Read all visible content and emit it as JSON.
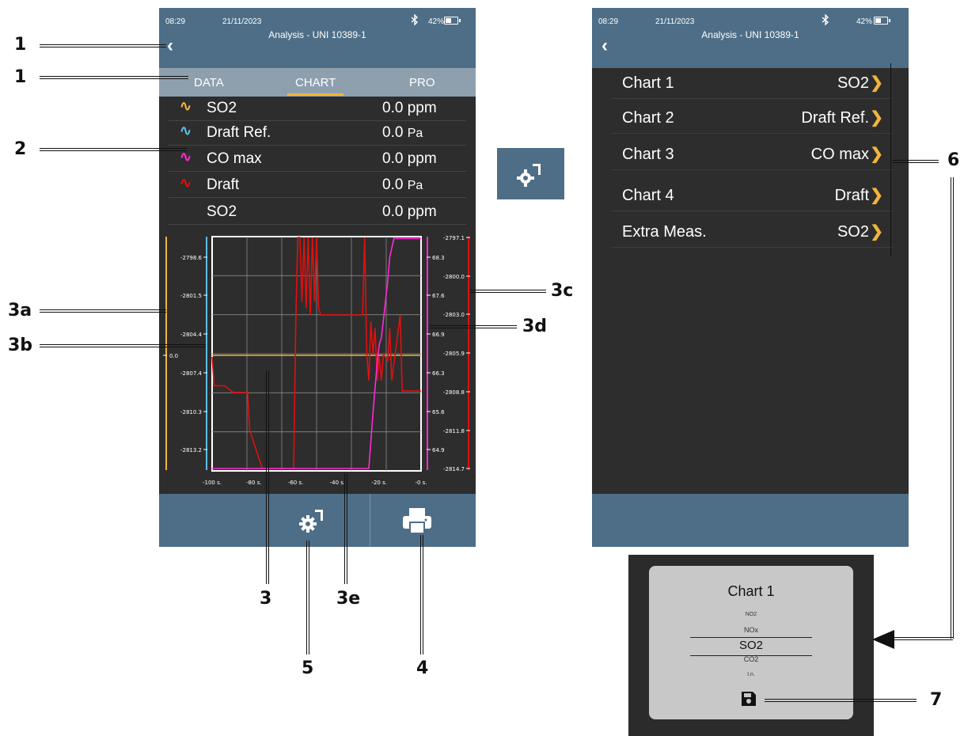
{
  "screen_left": {
    "status": {
      "time": "08:29",
      "date": "21/11/2023",
      "battery": "42%",
      "title": "Analysis - UNI 10389-1"
    },
    "tabs": [
      {
        "label": "DATA"
      },
      {
        "label": "CHART"
      },
      {
        "label": "PRO"
      }
    ],
    "active_tab": "CHART",
    "legend": [
      {
        "name": "SO2",
        "value": "0.0",
        "unit": "ppm",
        "icon": "yellow-trend-icon",
        "color": "#f2b43a"
      },
      {
        "name": "Draft Ref.",
        "value": "0.0",
        "unit": "Pa",
        "icon": "blue-trend-icon",
        "color": "#5bc0e6"
      },
      {
        "name": "CO max",
        "value": "0.0",
        "unit": "ppm",
        "icon": "magenta-trend-icon",
        "color": "#ff2ad4"
      },
      {
        "name": "Draft",
        "value": "0.0",
        "unit": "Pa",
        "icon": "red-trend-icon",
        "color": "#e01010"
      },
      {
        "name": "SO2",
        "value": "0.0",
        "unit": "ppm",
        "icon": "",
        "color": ""
      }
    ],
    "bottom_buttons": {
      "settings_icon": "gear-probe-icon",
      "print_icon": "printer-icon"
    }
  },
  "chart_data": {
    "type": "line",
    "x_ticks": [
      "-100 s.",
      "-80 s.",
      "-60 s.",
      "-40 s.",
      "-20 s.",
      "-0 s."
    ],
    "axis_a_ticks": [
      "0.0"
    ],
    "axis_b_ticks": [
      "-2798.6",
      "-2801.5",
      "-2804.4",
      "-2807.4",
      "-2810.3",
      "-2813.2"
    ],
    "axis_d_ticks": [
      "68.3",
      "67.6",
      "66.9",
      "66.3",
      "65.6",
      "64.9"
    ],
    "axis_c_ticks": [
      "-2797.1",
      "-2800.0",
      "-2803.0",
      "-2805.9",
      "-2808.8",
      "-2811.8",
      "-2814.7"
    ],
    "series": [
      {
        "color": "#f2b43a",
        "x": [
          -100,
          0
        ],
        "y": [
          0.0,
          0.0
        ]
      },
      {
        "color": "#e01010",
        "x": [
          -100,
          -99,
          -94,
          -90,
          -85,
          -83,
          -82,
          -76,
          -75,
          -61,
          -60,
          -59,
          -58,
          -57,
          -56,
          -55,
          -54,
          -53,
          -52,
          -51,
          -50,
          -49,
          -48,
          -47,
          -28,
          -27,
          -26,
          -25,
          -24,
          -23,
          -22,
          -21,
          -20,
          -19,
          -18,
          -16,
          -15,
          -14,
          -10,
          -9,
          -8,
          0
        ],
        "y": [
          -2806.2,
          -2808.4,
          -2808.4,
          -2808.9,
          -2808.9,
          -2808.9,
          -2811.8,
          -2814.7,
          -2814.7,
          -2814.7,
          -2804.0,
          -2797.1,
          -2797.1,
          -2802.0,
          -2797.1,
          -2802.5,
          -2797.1,
          -2803.0,
          -2797.1,
          -2802.0,
          -2797.1,
          -2802.5,
          -2803.0,
          -2803.0,
          -2803.0,
          -2797.1,
          -2806.0,
          -2808.0,
          -2803.5,
          -2806.0,
          -2804.0,
          -2808.0,
          -2806.2,
          -2808.0,
          -2806.0,
          -2806.5,
          -2804.0,
          -2808.0,
          -2803.0,
          -2808.8,
          -2808.8,
          -2808.8
        ]
      },
      {
        "color": "#ff2ad4",
        "x": [
          -100,
          -25,
          -23,
          -22,
          -21,
          -20,
          -19,
          -18,
          -17,
          -16,
          -15,
          -13,
          -12,
          0
        ],
        "y": [
          64.9,
          64.9,
          65.8,
          66.2,
          66.6,
          66.9,
          67.0,
          67.3,
          67.6,
          67.9,
          68.3,
          68.6,
          68.6,
          68.6
        ]
      }
    ]
  },
  "floating_settings_icon": "gear-probe-icon",
  "screen_right": {
    "status": {
      "time": "08:29",
      "date": "21/11/2023",
      "battery": "42%",
      "title": "Analysis - UNI 10389-1"
    },
    "rows": [
      {
        "label": "Chart 1",
        "value": "SO2"
      },
      {
        "label": "Chart 2",
        "value": "Draft Ref."
      },
      {
        "label": "Chart 3",
        "value": "CO max"
      },
      {
        "label": "Chart 4",
        "value": "Draft"
      },
      {
        "label": "Extra Meas.",
        "value": "SO2"
      }
    ]
  },
  "picker": {
    "title": "Chart 1",
    "options": [
      "NO2",
      "NOx",
      "SO2",
      "CO2",
      "I.n."
    ],
    "selected": "SO2",
    "save_icon": "floppy-disk-icon"
  },
  "callouts": {
    "c1a": "1",
    "c1b": "1",
    "c2": "2",
    "c3a": "3a",
    "c3b": "3b",
    "c3c": "3c",
    "c3d": "3d",
    "c3": "3",
    "c3e": "3e",
    "c4": "4",
    "c5": "5",
    "c6": "6",
    "c7": "7"
  }
}
